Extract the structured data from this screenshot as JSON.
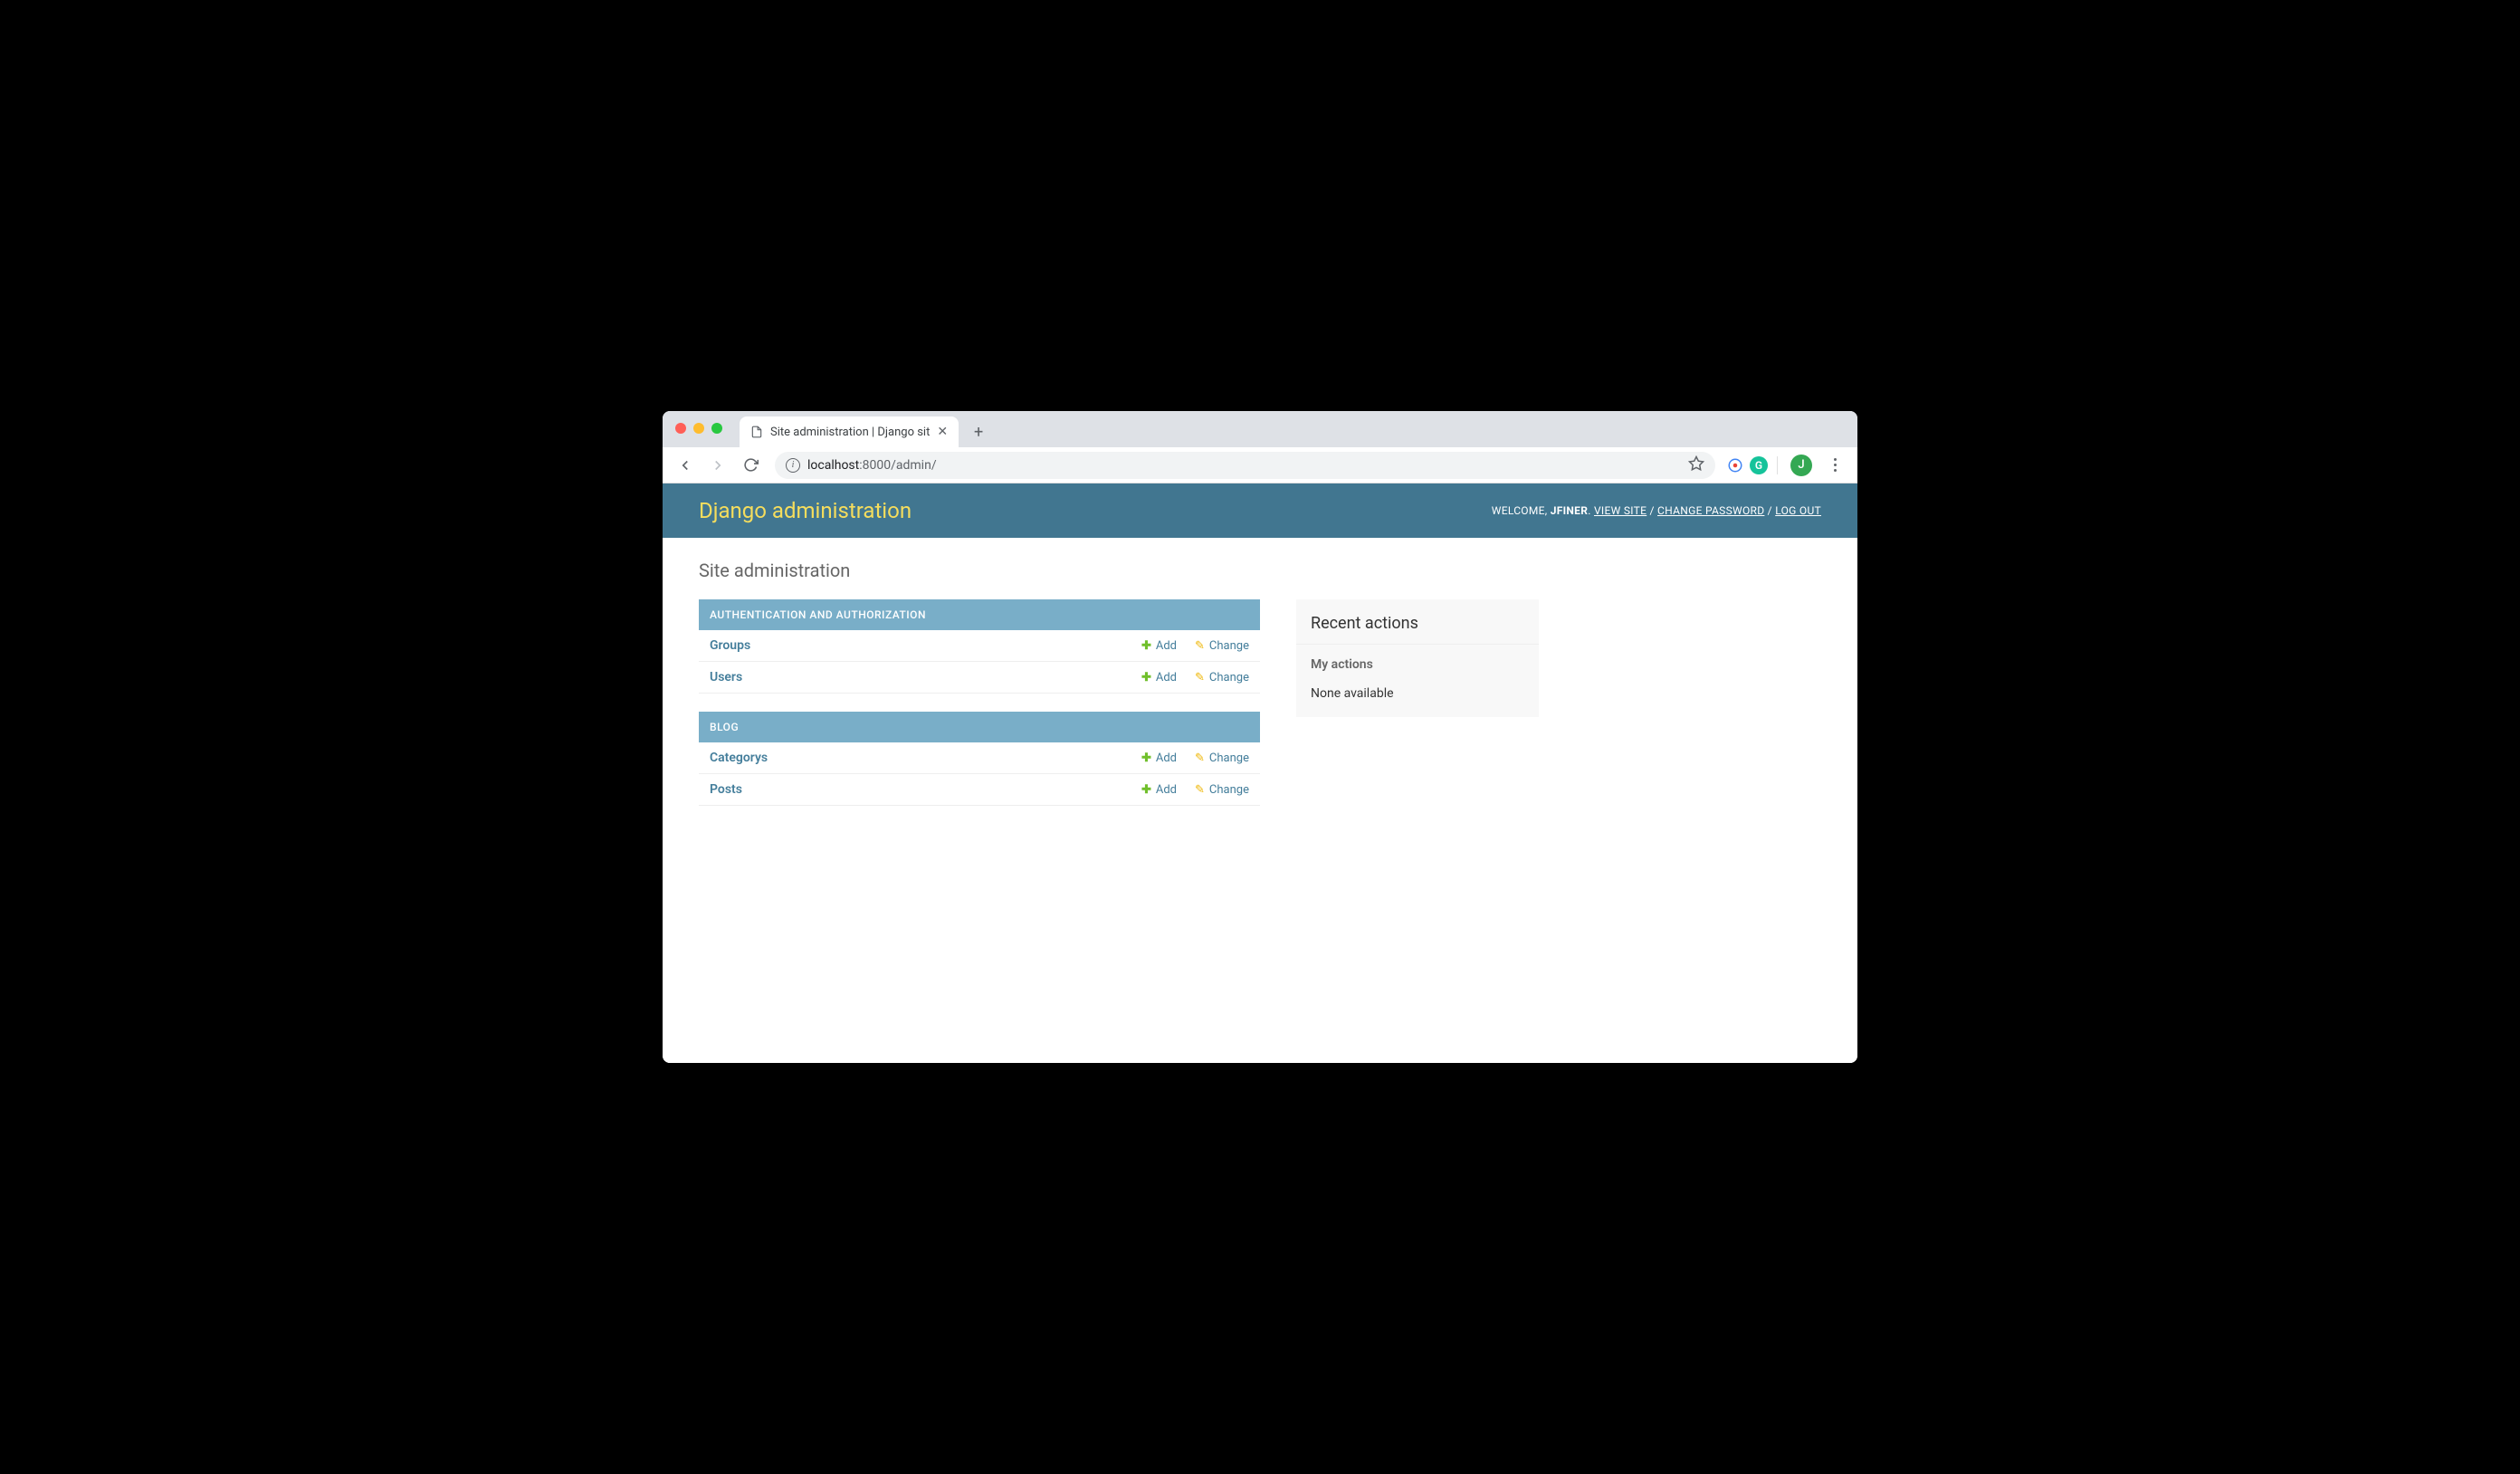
{
  "browser": {
    "tab_title": "Site administration | Django sit",
    "url_host": "localhost",
    "url_port_path": ":8000/admin/",
    "profile_letter": "J"
  },
  "header": {
    "title": "Django administration",
    "welcome": "WELCOME, ",
    "username": "JFINER",
    "view_site": "VIEW SITE",
    "change_password": "CHANGE PASSWORD",
    "log_out": "LOG OUT"
  },
  "page": {
    "heading": "Site administration"
  },
  "modules": [
    {
      "title": "AUTHENTICATION AND AUTHORIZATION",
      "models": [
        {
          "name": "Groups",
          "add": "Add",
          "change": "Change"
        },
        {
          "name": "Users",
          "add": "Add",
          "change": "Change"
        }
      ]
    },
    {
      "title": "BLOG",
      "models": [
        {
          "name": "Categorys",
          "add": "Add",
          "change": "Change"
        },
        {
          "name": "Posts",
          "add": "Add",
          "change": "Change"
        }
      ]
    }
  ],
  "sidebar": {
    "title": "Recent actions",
    "subtitle": "My actions",
    "none": "None available"
  }
}
